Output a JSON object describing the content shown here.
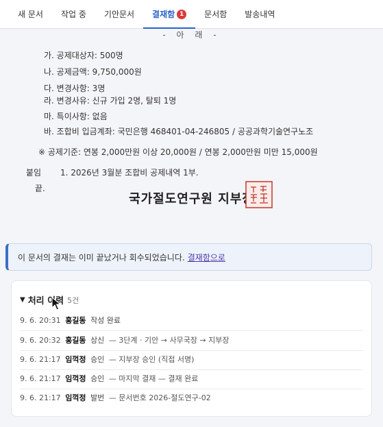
{
  "tabs": [
    {
      "label": "새 문서"
    },
    {
      "label": "작업 중"
    },
    {
      "label": "기안문서"
    },
    {
      "label": "결재함",
      "badge": "1",
      "active": true
    },
    {
      "label": "문서함"
    },
    {
      "label": "발송내역"
    }
  ],
  "document": {
    "heading": "- 아 래 -",
    "items": [
      "가. 공제대상자: 500명",
      "나. 공제금액: 9,750,000원",
      "다. 변경사항: 3명",
      "라. 변경사유: 신규 가입 2명, 탈퇴 1명",
      "마. 특이사항: 없음",
      "바. 조합비 입금계좌: 국민은행 468401-04-246805 / 공공과학기술연구노조"
    ],
    "note": "※ 공제기준: 연봉 2,000만원 이상 20,000원 / 연봉 2,000만원 미만 15,000원",
    "attachment_label": "붙임",
    "attachment_text": "1. 2026년 3월분 조합비 공제내역 1부.",
    "end_mark": "끝.",
    "organization": "국가절도연구원 지부장",
    "seal_text": "국가절도연구원지부장인"
  },
  "notice": {
    "text": "이 문서의 결재는 이미 끝났거나 회수되었습니다.",
    "link": "결재함으로"
  },
  "history": {
    "title": "처리 이력",
    "count": "5건",
    "rows": [
      {
        "time": "9. 6. 20:31",
        "actor": "홍길동",
        "action": "작성 완료",
        "detail": ""
      },
      {
        "time": "9. 6. 20:32",
        "actor": "홍길동",
        "action": "상신",
        "detail": "— 3단계 · 기안 → 사무국장 → 지부장"
      },
      {
        "time": "9. 6. 21:17",
        "actor": "임꺽정",
        "action": "승인",
        "detail": "— 지부장 승인 (직접 서명)"
      },
      {
        "time": "9. 6. 21:17",
        "actor": "임꺽정",
        "action": "승인",
        "detail": "— 마지막 결재 — 결재 완료"
      },
      {
        "time": "9. 6. 21:17",
        "actor": "임꺽정",
        "action": "발번",
        "detail": "— 문서번호 2026-절도연구-02"
      }
    ]
  },
  "colors": {
    "accent": "#2a63c9",
    "badge": "#d93a3a",
    "seal": "#c0392b",
    "link": "#4a3aa8"
  }
}
